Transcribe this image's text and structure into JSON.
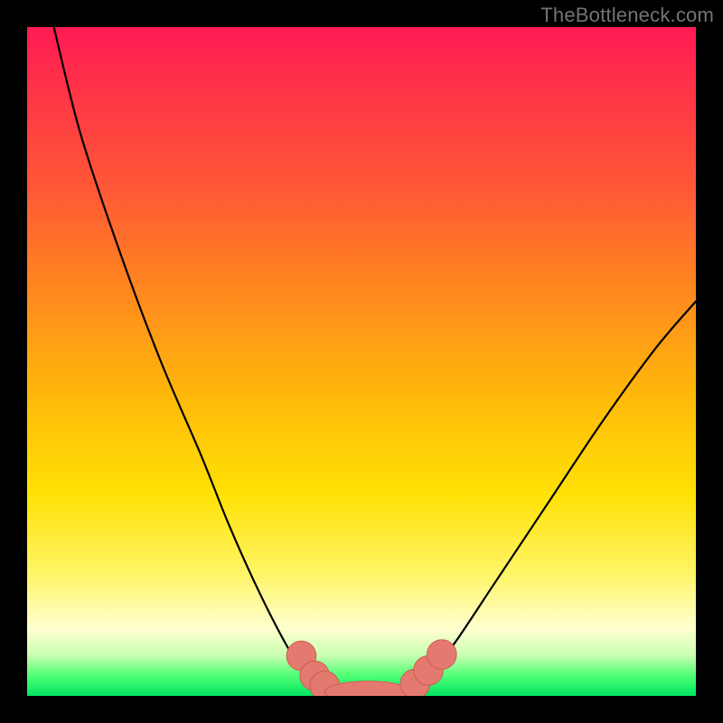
{
  "attribution": "TheBottleneck.com",
  "colors": {
    "background": "#000000",
    "curve_stroke": "#000000",
    "marker_fill": "#e47a6f",
    "marker_stroke": "#cf5a52",
    "gradient_top": "#ff1a53",
    "gradient_bottom": "#00e562"
  },
  "chart_data": {
    "type": "line",
    "title": "",
    "xlabel": "",
    "ylabel": "",
    "xlim": [
      0,
      100
    ],
    "ylim": [
      0,
      100
    ],
    "series": [
      {
        "name": "bottleneck-curve-left",
        "x": [
          4,
          8,
          14,
          20,
          26,
          30,
          34,
          38,
          41,
          43,
          45
        ],
        "y": [
          100,
          84,
          66,
          50,
          36,
          26,
          17,
          9,
          4,
          2,
          1
        ]
      },
      {
        "name": "bottleneck-floor",
        "x": [
          45,
          48,
          51,
          54,
          57
        ],
        "y": [
          1,
          0.5,
          0.5,
          0.5,
          1
        ]
      },
      {
        "name": "bottleneck-curve-right",
        "x": [
          57,
          60,
          64,
          70,
          78,
          86,
          94,
          100
        ],
        "y": [
          1,
          3,
          8,
          17,
          29,
          41,
          52,
          59
        ]
      }
    ],
    "markers": {
      "name": "highlighted-points",
      "points": [
        {
          "x": 41,
          "y": 6,
          "r": 2.2
        },
        {
          "x": 43,
          "y": 3,
          "r": 2.2
        },
        {
          "x": 44.5,
          "y": 1.5,
          "r": 2.2
        },
        {
          "x": 51,
          "y": 0.6,
          "r_x": 6.5,
          "r_y": 1.6,
          "shape": "pill"
        },
        {
          "x": 58,
          "y": 1.8,
          "r": 2.2
        },
        {
          "x": 60,
          "y": 3.8,
          "r": 2.2
        },
        {
          "x": 62,
          "y": 6.2,
          "r": 2.2
        }
      ]
    }
  }
}
